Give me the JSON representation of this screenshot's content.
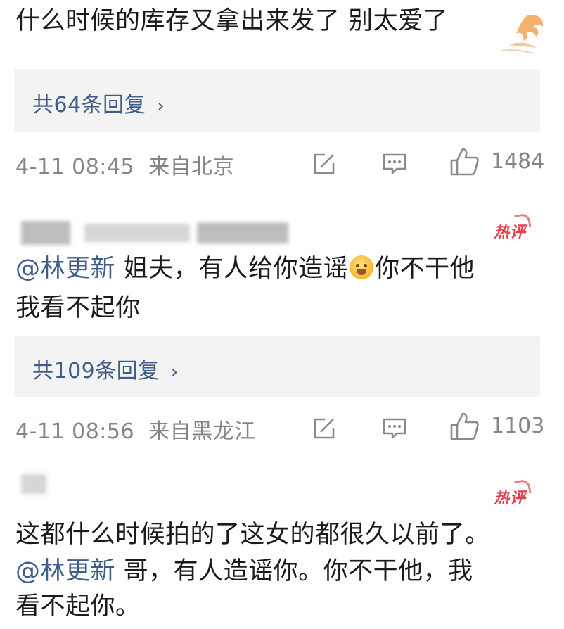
{
  "comments": [
    {
      "text_lines": [
        "什么时候的库存又拿出来发了 别太爱了"
      ],
      "reply_link": "共64条回复",
      "time": "4-11 08:45",
      "location": "来自北京",
      "likes": "1484"
    },
    {
      "hot_badge": "热评",
      "mention": "@林更新",
      "text_line1_part1": " 姐夫，有人给你造谣",
      "text_line1_part2": "你不干他",
      "text_line2": "我看不起你",
      "reply_link": "共109条回复",
      "time": "4-11 08:56",
      "location": "来自黑龙江",
      "likes": "1103",
      "emoji": "cold-sweat-face-emoji"
    },
    {
      "hot_badge": "热评",
      "text_line1": "这都什么时候拍的了这女的都很久以前了。",
      "mention": "@林更新",
      "text_line2_rest": " 哥，有人造谣你。你不干他，我",
      "text_line3": "看不起你。"
    }
  ],
  "reply_chevron": "›",
  "icons": {
    "share": "share-icon",
    "comment": "comment-icon",
    "like": "thumbs-up-icon",
    "decoration": "phoenix-icon"
  },
  "colors": {
    "link": "#3f5d8a",
    "meta": "#858585",
    "hot_badge": "#e0424c",
    "reply_bg": "#f3f3f3"
  }
}
